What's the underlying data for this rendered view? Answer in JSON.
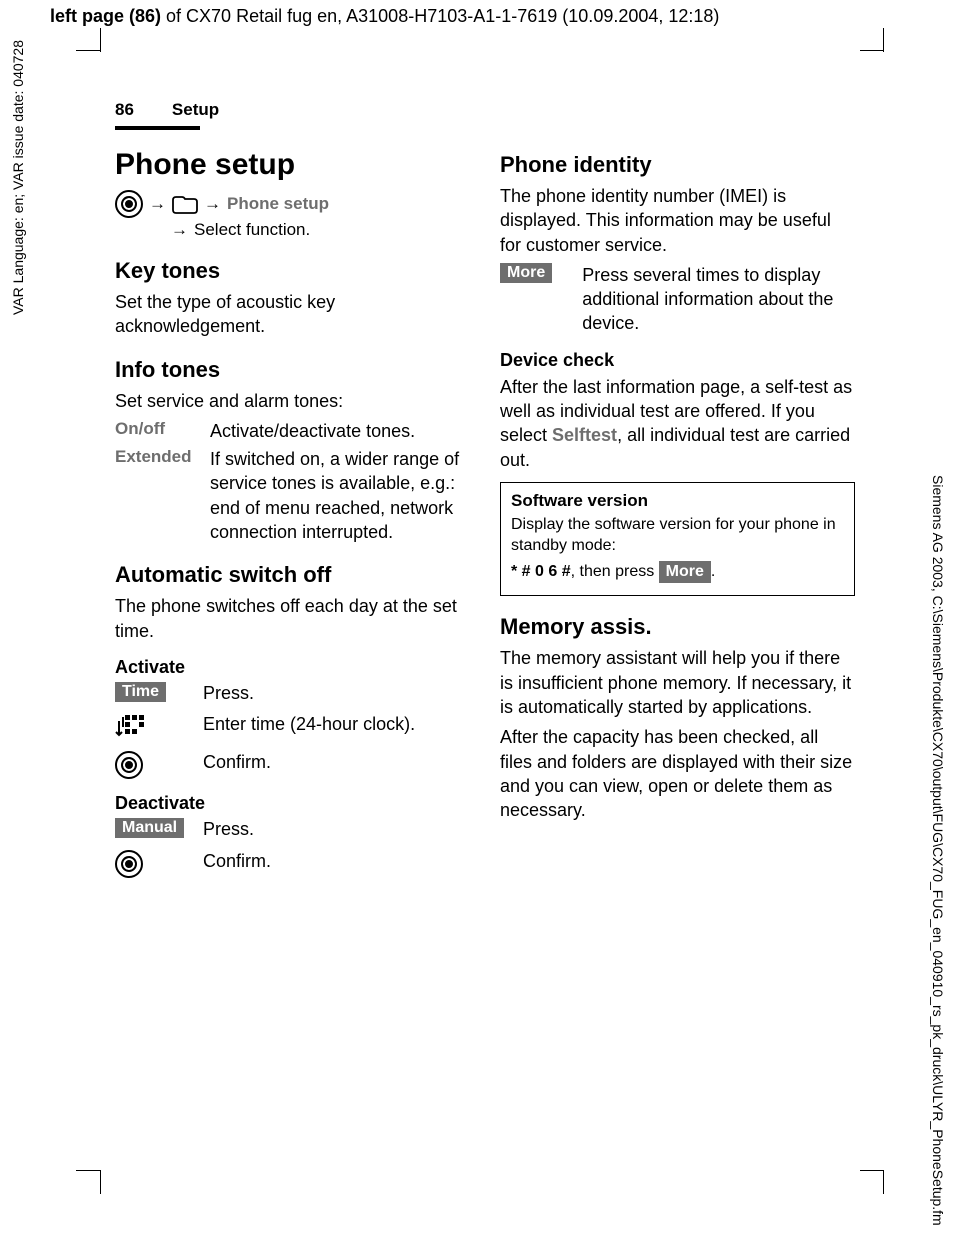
{
  "header": {
    "prefix_bold": "left page (86)",
    "rest": " of CX70 Retail fug en, A31008-H7103-A1-1-7619 (10.09.2004, 12:18)"
  },
  "side_left": "VAR Language: en; VAR issue date: 040728",
  "side_right": "Siemens AG 2003, C:\\Siemens\\Produkte\\CX70\\output\\FUG\\CX70_FUG_en_040910_rs_pk_druck\\ULYR_PhoneSetup.fm",
  "running": {
    "page": "86",
    "section": "Setup"
  },
  "col1": {
    "title": "Phone setup",
    "nav_label": "Phone setup",
    "nav_sub": "Select function.",
    "key_tones_h": "Key tones",
    "key_tones_p": "Set the type of acoustic key acknowledgement.",
    "info_tones_h": "Info tones",
    "info_tones_p": "Set service and alarm tones:",
    "kv1_k": "On/off",
    "kv1_v": "Activate/deactivate tones.",
    "kv2_k": "Extended",
    "kv2_v": "If switched on, a wider range of service tones is available, e.g.: end of menu reached, network connection interrupted.",
    "auto_h": "Automatic switch off",
    "auto_p": "The phone switches off each day at the set time.",
    "activate_h": "Activate",
    "time_key": "Time",
    "time_press": "Press.",
    "enter_time": "Enter time (24-hour clock).",
    "confirm": "Confirm.",
    "deactivate_h": "Deactivate",
    "manual_key": "Manual",
    "manual_press": "Press.",
    "confirm2": "Confirm."
  },
  "col2": {
    "identity_h": "Phone identity",
    "identity_p": "The phone identity number (IMEI) is displayed. This information may be useful for customer service.",
    "more_key": "More",
    "more_txt": "Press several times to display additional information about the device.",
    "dev_check_h": "Device check",
    "dev_check_p1": "After the last information page, a self-test as well as individual test are offered. If you select ",
    "dev_check_selftest": "Selftest",
    "dev_check_p2": ", all individual test are carried out.",
    "box_h": "Software version",
    "box_p": "Display the software version for your phone in standby mode:",
    "box_code": "* # 0 6 #",
    "box_then": ", then press ",
    "box_more": "More",
    "box_dot": ".",
    "mem_h": "Memory assis.",
    "mem_p1": "The memory assistant will help you if there is insufficient phone memory. If necessary, it is automatically started by applications.",
    "mem_p2": "After the capacity has been checked, all files and folders are displayed with their size and you can view, open or delete them as necessary."
  }
}
